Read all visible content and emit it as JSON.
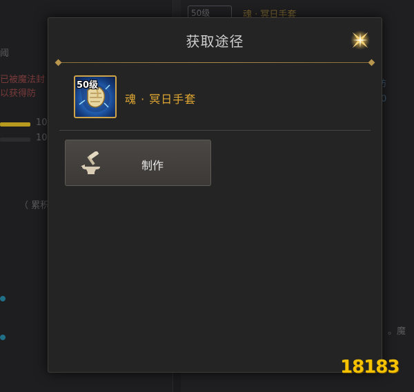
{
  "dialog": {
    "title": "获取途径",
    "item": {
      "level_badge": "50级",
      "name": "魂 · 冥日手套",
      "icon": "glove-icon"
    },
    "sources": [
      {
        "label": "制作",
        "icon": "anvil-hammer-icon"
      }
    ],
    "close_icon": "close-star-icon"
  },
  "background": {
    "item_badge": "50级",
    "item_title": "魂 · 冥日手套",
    "left_texts": [
      "阈",
      "已被魔法封",
      "以获得防",
      "10",
      "10",
      "（ 累积"
    ],
    "right_texts": [
      "防",
      "0",
      "世",
      "。魔"
    ]
  },
  "watermark": "18183",
  "colors": {
    "accent_gold": "#e0a832",
    "title": "#cfcfcf",
    "panel": "#242424"
  }
}
